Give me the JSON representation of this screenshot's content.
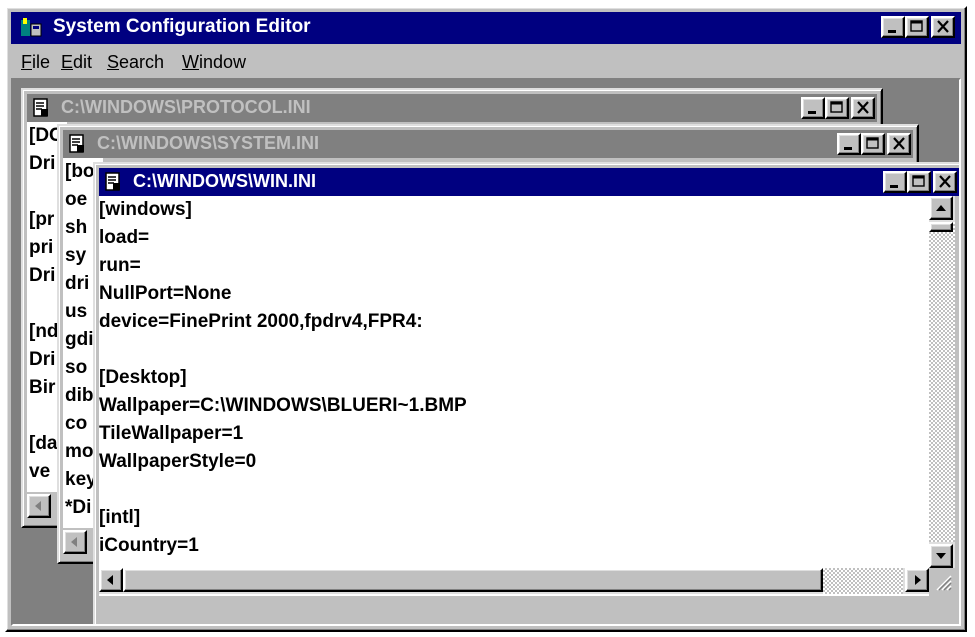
{
  "app": {
    "title": "System Configuration Editor",
    "controls": [
      "minimize-icon",
      "maximize-icon",
      "close-icon"
    ]
  },
  "menu": [
    {
      "label": "File",
      "mnemonic": "F",
      "rest": "ile"
    },
    {
      "label": "Edit",
      "mnemonic": "E",
      "rest": "dit"
    },
    {
      "label": "Search",
      "mnemonic": "S",
      "rest": "earch"
    },
    {
      "label": "Window",
      "mnemonic": "W",
      "rest": "indow"
    }
  ],
  "windows": {
    "protocol": {
      "title": "C:\\WINDOWS\\PROTOCOL.INI",
      "visible_lines": [
        "[DC",
        "Dri",
        "",
        "[pr",
        "pri",
        "Dri",
        "",
        "[nd",
        "Dri",
        "Bir",
        "",
        "[da",
        "ve"
      ]
    },
    "system": {
      "title": "C:\\WINDOWS\\SYSTEM.INI",
      "visible_lines": [
        "[bo",
        "oe",
        "sh",
        "sy",
        "dri",
        "us",
        "gdi",
        "so",
        "dib",
        "co",
        "mo",
        "key",
        "*Di"
      ]
    },
    "win": {
      "title": "C:\\WINDOWS\\WIN.INI",
      "lines": [
        "[windows]",
        "load=",
        "run=",
        "NullPort=None",
        "device=FinePrint 2000,fpdrv4,FPR4:",
        "",
        "[Desktop]",
        "Wallpaper=C:\\WINDOWS\\BLUERI~1.BMP",
        "TileWallpaper=1",
        "WallpaperStyle=0",
        "",
        "[intl]",
        "iCountry=1"
      ]
    }
  },
  "colors": {
    "active_title": "#000080",
    "inactive_title": "#808080",
    "face": "#c0c0c0",
    "workspace": "#808080"
  }
}
